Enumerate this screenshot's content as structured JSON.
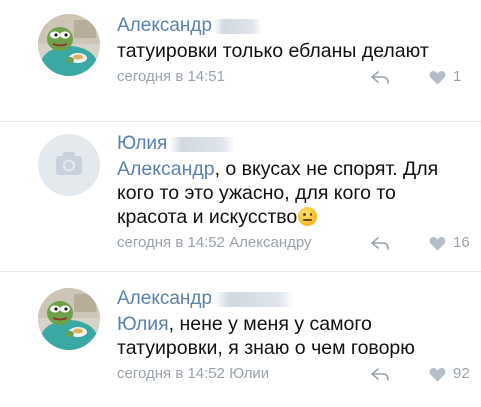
{
  "comments": [
    {
      "author": "Александр",
      "text": "татуировки только ебланы делают",
      "time": "сегодня в 14:51",
      "reply_to": "",
      "likes": "1",
      "avatar": "pepe-frog-avatar"
    },
    {
      "author": "Юлия",
      "mention": "Александр",
      "text": ", о вкусах не спорят. Для кого то это ужасно,  для кого то красота и искусство",
      "emoji": "confused-face-emoji",
      "time": "сегодня в 14:52",
      "reply_to": "Александру",
      "likes": "16",
      "avatar": "camera-placeholder-avatar"
    },
    {
      "author": "Александр",
      "mention": "Юлия",
      "text": ", нене у меня у самого татуировки, я знаю о чем говорю",
      "time": "сегодня в 14:52",
      "reply_to": "Юлии",
      "likes": "92",
      "avatar": "pepe-frog-avatar"
    }
  ],
  "colors": {
    "author_link": "#5b82ad",
    "meta_gray": "#9aa3ad",
    "divider": "#e3e6ea"
  }
}
